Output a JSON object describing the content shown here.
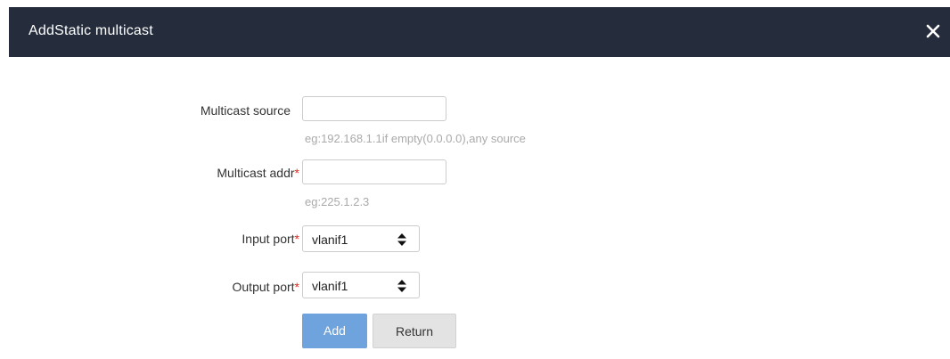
{
  "dialog": {
    "title": "AddStatic multicast"
  },
  "form": {
    "source": {
      "label": "Multicast source",
      "value": "",
      "hint": "eg:192.168.1.1if empty(0.0.0.0),any source"
    },
    "address": {
      "label": "Multicast addr",
      "required_mark": "*",
      "value": "",
      "hint": "eg:225.1.2.3"
    },
    "input_port": {
      "label": "Input port",
      "required_mark": "*",
      "selected": "vlanif1"
    },
    "output_port": {
      "label": "Output port",
      "required_mark": "*",
      "selected": "vlanif1"
    }
  },
  "actions": {
    "add_label": "Add",
    "return_label": "Return"
  },
  "colors": {
    "titlebar": "#252d3d",
    "primary_button": "#6ea3de",
    "required": "#e0281e"
  },
  "icons": {
    "close": "close-icon",
    "select_arrow": "sort-arrows-icon"
  }
}
